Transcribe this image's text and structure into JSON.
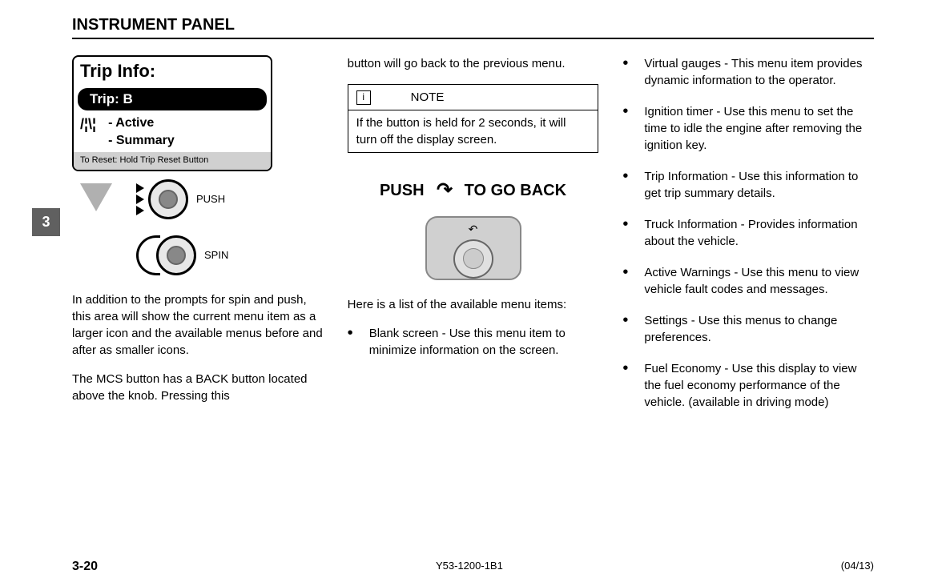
{
  "header": "INSTRUMENT PANEL",
  "chapter_tab": "3",
  "tripInfo": {
    "title": "Trip Info:",
    "selected": "Trip: B",
    "options": [
      "- Active",
      "- Summary"
    ],
    "resetText": "To Reset: Hold Trip Reset Button"
  },
  "knob": {
    "push": "PUSH",
    "spin": "SPIN"
  },
  "col1": {
    "para1": "In addition to the prompts for spin and push, this area will show the current menu item as a larger icon and the available menus before and after as smaller icons.",
    "para2": "The MCS button has a BACK button located above the knob. Pressing this"
  },
  "col2": {
    "para1": "button will go back to the previous menu.",
    "note": {
      "icon": "i",
      "label": "NOTE",
      "body": "If the button is held for 2 seconds, it will turn off the display screen."
    },
    "pushBack": {
      "push": "PUSH",
      "goBack": "TO GO BACK"
    },
    "para2": "Here is a list of the available menu items:",
    "list1": "Blank screen - Use this menu item to minimize information on the screen."
  },
  "col3": {
    "items": [
      "Virtual gauges - This menu item provides dynamic information to the operator.",
      "Ignition timer - Use this menu to set the time to idle the engine after removing the ignition key.",
      "Trip Information - Use this information to get trip summary details.",
      "Truck Information - Provides information about the vehicle.",
      "Active Warnings - Use this menu to view vehicle fault codes and messages.",
      "Settings - Use this menus to change preferences.",
      "Fuel Economy - Use this display to view the fuel economy performance of the vehicle. (available in driving mode)"
    ]
  },
  "footer": {
    "pageNum": "3-20",
    "docId": "Y53-1200-1B1",
    "date": "(04/13)"
  }
}
